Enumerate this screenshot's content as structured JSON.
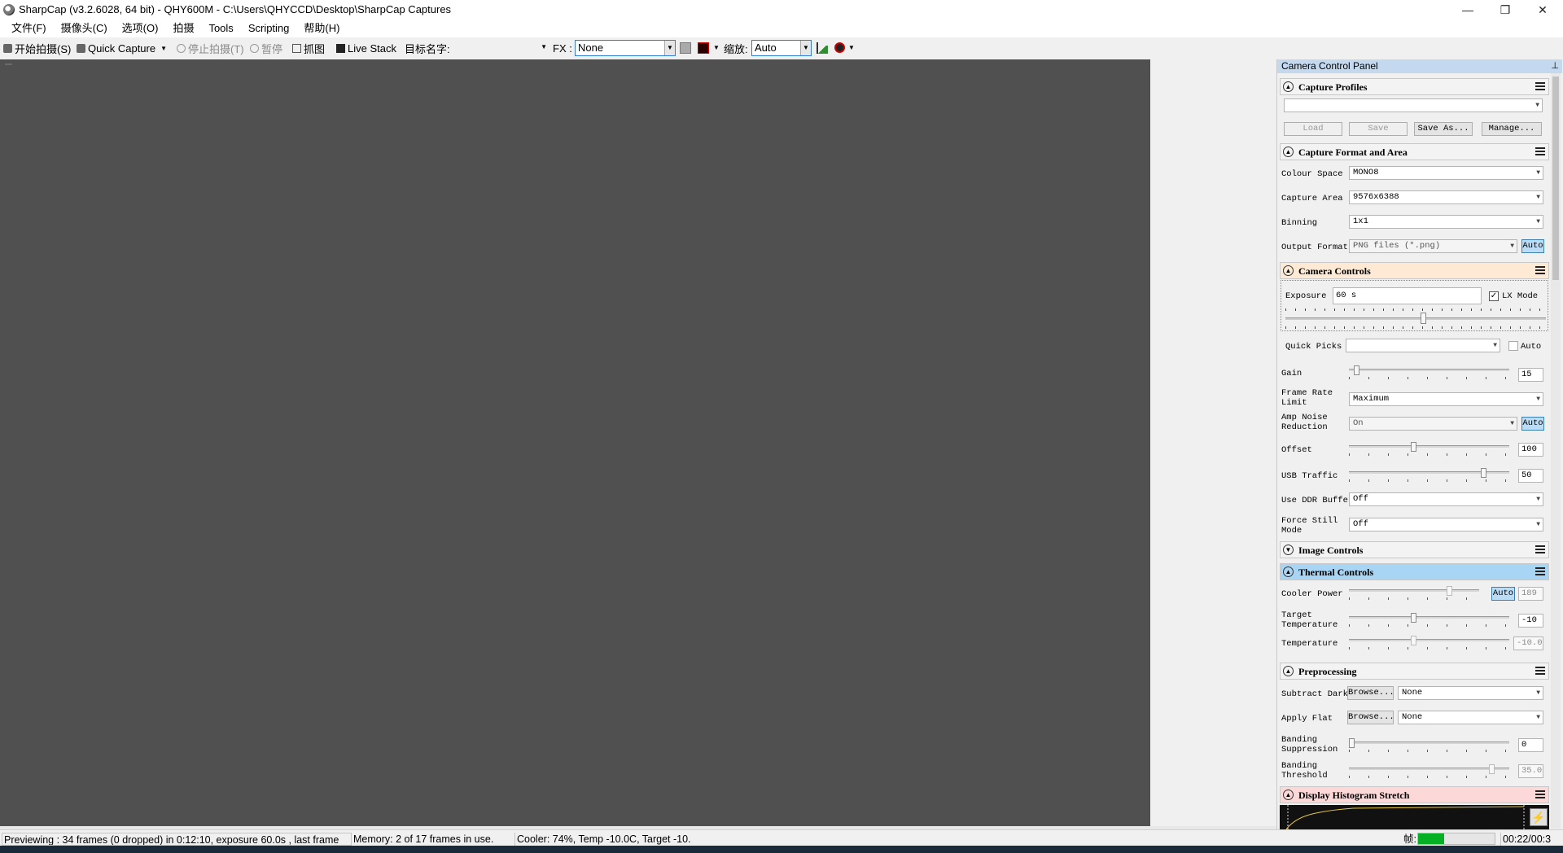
{
  "window": {
    "title": "SharpCap (v3.2.6028, 64 bit) - QHY600M - C:\\Users\\QHYCCD\\Desktop\\SharpCap Captures",
    "controls": {
      "minimize": "—",
      "restore": "❐",
      "close": "✕"
    }
  },
  "menu": [
    "文件(F)",
    "摄像头(C)",
    "选项(O)",
    "拍摄",
    "Tools",
    "Scripting",
    "帮助(H)"
  ],
  "toolbar": {
    "start_capture": "开始拍摄(S)",
    "quick_capture": "Quick Capture",
    "stop_capture": "停止拍摄(T)",
    "pause": "暂停",
    "snapshot": "抓图",
    "live_stack": "Live Stack",
    "target_name_label": "目标名字:",
    "target_name_value": "",
    "fx_label": "FX :",
    "fx_value": "None",
    "zoom_label": "缩放:",
    "zoom_value": "Auto"
  },
  "panel": {
    "title": "Camera Control Panel",
    "pin": "⊥",
    "capture_profiles": {
      "title": "Capture Profiles",
      "profile_value": "",
      "load": "Load",
      "save": "Save",
      "save_as": "Save As...",
      "manage": "Manage..."
    },
    "capture_format": {
      "title": "Capture Format and Area",
      "colour_space_label": "Colour Space",
      "colour_space": "MONO8",
      "capture_area_label": "Capture Area",
      "capture_area": "9576x6388",
      "binning_label": "Binning",
      "binning": "1x1",
      "output_format_label": "Output Format",
      "output_format": "PNG files (*.png)",
      "auto": "Auto"
    },
    "camera_controls": {
      "title": "Camera Controls",
      "exposure_label": "Exposure",
      "exposure_value": "60 s",
      "lx_mode_label": "LX Mode",
      "lx_mode_checked": true,
      "quick_picks_label": "Quick Picks",
      "quick_picks_value": "",
      "quick_picks_auto": "Auto",
      "gain_label": "Gain",
      "gain_value": "15",
      "frame_rate_label": "Frame Rate\nLimit",
      "frame_rate_value": "Maximum",
      "amp_noise_label": "Amp Noise\nReduction",
      "amp_noise_value": "On",
      "amp_noise_auto": "Auto",
      "offset_label": "Offset",
      "offset_value": "100",
      "usb_traffic_label": "USB Traffic",
      "usb_traffic_value": "50",
      "ddr_label": "Use DDR Buffer",
      "ddr_value": "Off",
      "force_still_label": "Force Still\nMode",
      "force_still_value": "Off"
    },
    "image_controls": {
      "title": "Image Controls"
    },
    "thermal_controls": {
      "title": "Thermal Controls",
      "cooler_power_label": "Cooler Power",
      "cooler_power_auto": "Auto",
      "cooler_power_value": "189",
      "target_temp_label": "Target\nTemperature",
      "target_temp_value": "-10",
      "temperature_label": "Temperature",
      "temperature_value": "-10.0"
    },
    "preprocessing": {
      "title": "Preprocessing",
      "subtract_dark_label": "Subtract Dark",
      "subtract_dark_browse": "Browse...",
      "subtract_dark_value": "None",
      "apply_flat_label": "Apply Flat",
      "apply_flat_browse": "Browse...",
      "apply_flat_value": "None",
      "banding_suppression_label": "Banding\nSuppression",
      "banding_suppression_value": "0",
      "banding_threshold_label": "Banding\nThreshold",
      "banding_threshold_value": "35.0"
    },
    "histogram": {
      "title": "Display Histogram Stretch"
    }
  },
  "status": {
    "preview": "Previewing : 34 frames (0 dropped) in 0:12:10, exposure 60.0s , last frame",
    "memory": "Memory: 2 of 17 frames in use.",
    "cooler": "Cooler: 74%, Temp -10.0C, Target -10.",
    "frame_label": "帧:",
    "time": "00:22/00:3"
  }
}
